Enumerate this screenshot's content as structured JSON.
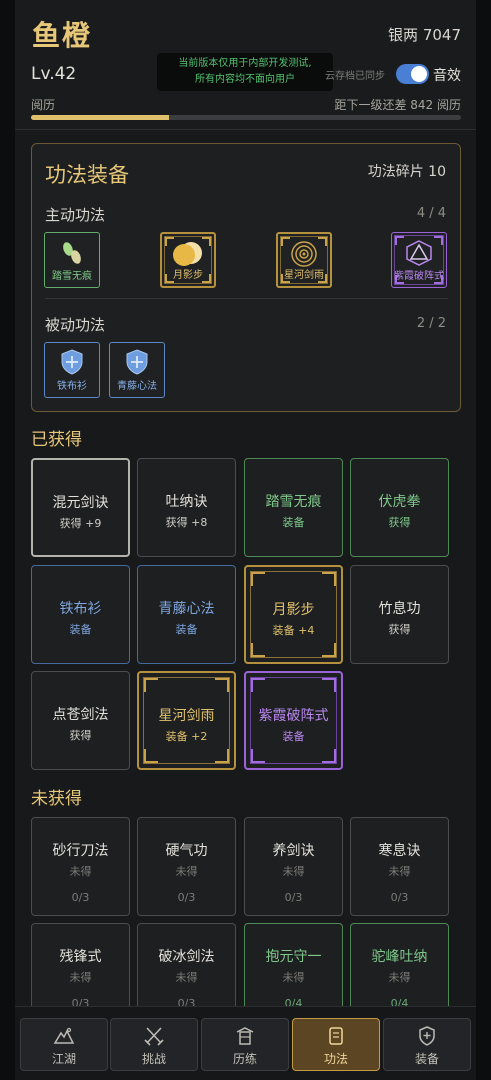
{
  "header": {
    "player_name": "鱼橙",
    "currency": "银两 7047",
    "level": "Lv.42",
    "dev_notice_line1": "当前版本仅用于内部开发测试,",
    "dev_notice_line2": "所有内容均不面向用户",
    "cloud_sync": "云存档已同步",
    "sound_label": "音效",
    "sound_on": true,
    "exp_label": "阅历",
    "exp_remaining": "距下一级还差 842 阅历",
    "exp_progress": 0.32
  },
  "equip": {
    "title": "功法装备",
    "fragments": "功法碎片 10",
    "active_title": "主动功法",
    "active_count": "4 / 4",
    "active_slots": [
      {
        "name": "踏雪无痕",
        "tier": "green",
        "icon": "footprints-icon"
      },
      {
        "name": "月影步",
        "tier": "gold",
        "icon": "moon-icon"
      },
      {
        "name": "星河剑雨",
        "tier": "gold",
        "icon": "vortex-icon"
      },
      {
        "name": "紫霞破阵式",
        "tier": "purple",
        "icon": "triangle-formation-icon"
      }
    ],
    "passive_title": "被动功法",
    "passive_count": "2 / 2",
    "passive_slots": [
      {
        "name": "铁布衫",
        "tier": "blue",
        "icon": "shield-icon"
      },
      {
        "name": "青藤心法",
        "tier": "blue",
        "icon": "shield-icon"
      }
    ]
  },
  "owned": {
    "heading": "已获得",
    "cards": [
      {
        "name": "混元剑诀",
        "status": "获得 +9",
        "tier": "white"
      },
      {
        "name": "吐纳诀",
        "status": "获得 +8",
        "tier": "plain"
      },
      {
        "name": "踏雪无痕",
        "status": "装备",
        "tier": "green"
      },
      {
        "name": "伏虎拳",
        "status": "获得",
        "tier": "green"
      },
      {
        "name": "铁布衫",
        "status": "装备",
        "tier": "blue"
      },
      {
        "name": "青藤心法",
        "status": "装备",
        "tier": "blue"
      },
      {
        "name": "月影步",
        "status": "装备 +4",
        "tier": "gold"
      },
      {
        "name": "竹息功",
        "status": "获得",
        "tier": "plain"
      },
      {
        "name": "点苍剑法",
        "status": "获得",
        "tier": "plain"
      },
      {
        "name": "星河剑雨",
        "status": "装备 +2",
        "tier": "gold"
      },
      {
        "name": "紫霞破阵式",
        "status": "装备",
        "tier": "purple"
      }
    ]
  },
  "unowned": {
    "heading": "未获得",
    "cards": [
      {
        "name": "砂行刀法",
        "status": "未得",
        "progress": "0/3",
        "tier": "plain"
      },
      {
        "name": "硬气功",
        "status": "未得",
        "progress": "0/3",
        "tier": "plain"
      },
      {
        "name": "养剑诀",
        "status": "未得",
        "progress": "0/3",
        "tier": "plain"
      },
      {
        "name": "寒息诀",
        "status": "未得",
        "progress": "0/3",
        "tier": "plain"
      },
      {
        "name": "残锋式",
        "status": "未得",
        "progress": "0/3",
        "tier": "plain"
      },
      {
        "name": "破冰剑法",
        "status": "未得",
        "progress": "0/3",
        "tier": "plain"
      },
      {
        "name": "抱元守一",
        "status": "未得",
        "progress": "0/4",
        "tier": "green"
      },
      {
        "name": "驼峰吐纳",
        "status": "未得",
        "progress": "0/4",
        "tier": "green"
      }
    ]
  },
  "nav": {
    "items": [
      {
        "label": "江湖",
        "icon": "mountain-icon",
        "active": false
      },
      {
        "label": "挑战",
        "icon": "crossed-swords-icon",
        "active": false
      },
      {
        "label": "历练",
        "icon": "pagoda-icon",
        "active": false
      },
      {
        "label": "功法",
        "icon": "scroll-icon",
        "active": true
      },
      {
        "label": "装备",
        "icon": "shield-plus-icon",
        "active": false
      }
    ]
  },
  "colors": {
    "accent_gold": "#e7c778",
    "tier_green": "#7fc88a",
    "tier_blue": "#7ea6e0",
    "tier_purple": "#b987ef",
    "toggle_blue": "#4a7fd6"
  }
}
